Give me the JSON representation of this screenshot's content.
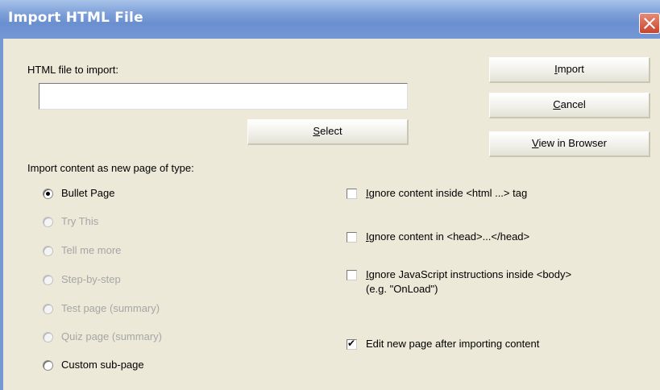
{
  "window": {
    "title": "Import HTML File"
  },
  "file": {
    "label": "HTML file to import:",
    "value": "",
    "select_label": "Select",
    "select_underline": "S",
    "select_rest": "elect"
  },
  "buttons": {
    "import": {
      "underline": "I",
      "rest": "mport"
    },
    "cancel": {
      "underline": "C",
      "rest": "ancel"
    },
    "view": {
      "underline": "V",
      "rest": "iew in Browser"
    }
  },
  "page_type": {
    "label": "Import content as new page of type:",
    "options": [
      {
        "label": "Bullet Page",
        "checked": true,
        "enabled": true
      },
      {
        "label": "Try This",
        "checked": false,
        "enabled": false
      },
      {
        "label": "Tell me more",
        "checked": false,
        "enabled": false
      },
      {
        "label": "Step-by-step",
        "checked": false,
        "enabled": false
      },
      {
        "label": "Test page (summary)",
        "checked": false,
        "enabled": false
      },
      {
        "label": "Quiz page (summary)",
        "checked": false,
        "enabled": false
      },
      {
        "label": "Custom sub-page",
        "checked": false,
        "enabled": true
      }
    ]
  },
  "options": {
    "ignore_html": {
      "underline": "I",
      "rest": "gnore content inside  <html ...> tag",
      "checked": false
    },
    "ignore_head": {
      "underline": "I",
      "rest": "gnore content in <head>...</head>",
      "checked": false
    },
    "ignore_js": {
      "underline": "I",
      "rest": "gnore JavaScript instructions inside <body>",
      "line2": "(e.g. \"OnLoad\")",
      "checked": false
    },
    "edit_after": {
      "label": "Edit new page after importing content",
      "checked": true
    }
  }
}
